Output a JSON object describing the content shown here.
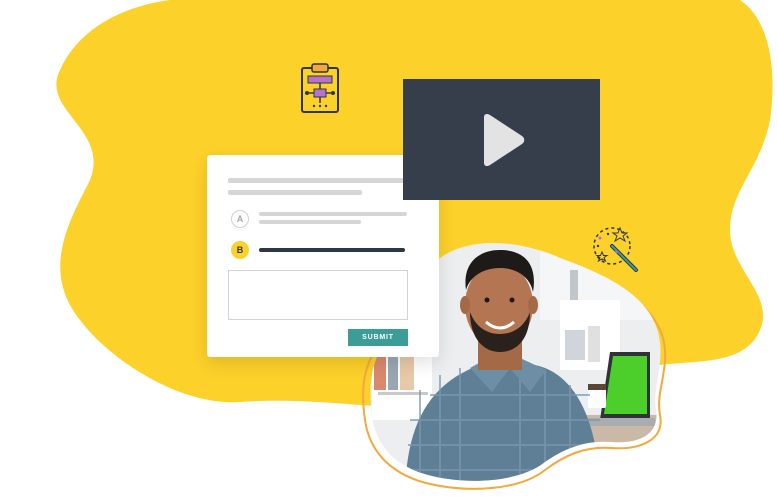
{
  "quiz": {
    "option_a_letter": "A",
    "option_b_letter": "B",
    "submit_label": "SUBMIT",
    "selected_option": "B"
  },
  "video": {
    "play_icon": "play-icon"
  },
  "icons": {
    "decor_top": "clipboard-flowchart-icon",
    "decor_right": "magic-wand-icon"
  },
  "colors": {
    "blob_yellow": "#fcd12a",
    "video_dark": "#363d4b",
    "submit_teal": "#3c9c98",
    "outline_orange": "#f2a93b",
    "accent_purple": "#b673c9"
  }
}
